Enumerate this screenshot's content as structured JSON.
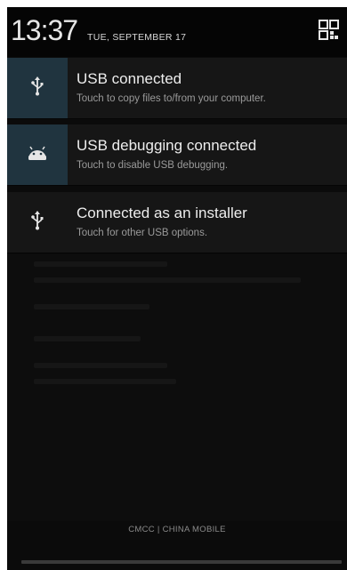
{
  "header": {
    "time": "13:37",
    "date": "TUE, SEPTEMBER 17",
    "quick_settings_icon": "quick-settings-grid-icon"
  },
  "notifications": [
    {
      "icon": "usb-icon",
      "title": "USB connected",
      "subtitle": "Touch to copy files to/from your computer.",
      "icon_bg": "#20343f"
    },
    {
      "icon": "android-debug-icon",
      "title": "USB debugging connected",
      "subtitle": "Touch to disable USB debugging.",
      "icon_bg": "#20343f"
    },
    {
      "icon": "usb-icon",
      "title": "Connected as an installer",
      "subtitle": "Touch for other USB options.",
      "icon_bg": "#161616"
    }
  ],
  "footer": {
    "carrier": "CMCC | CHINA MOBILE"
  }
}
